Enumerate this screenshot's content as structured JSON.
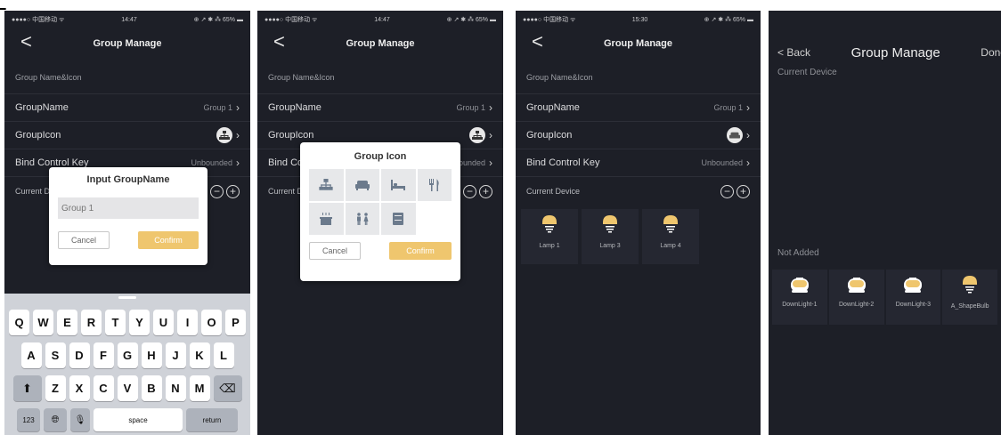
{
  "colors": {
    "screen_bg": "#1d1f27",
    "accent": "#efc66e",
    "dialog_bg": "#ffffff",
    "tile_bg": "#252731"
  },
  "screen1": {
    "status": {
      "left": "●●●●○ 中国移动 ᯤ",
      "time": "14:47",
      "right": "⊕ ↗ ✱ ⁂ 65% ▬"
    },
    "nav": {
      "back": "<",
      "title": "Group Manage"
    },
    "section_title": "Group Name&Icon",
    "rows": [
      {
        "label": "GroupName",
        "value": "Group 1"
      },
      {
        "label": "GroupIcon",
        "value": ""
      },
      {
        "label": "Bind Control Key",
        "value": "Unbounded"
      }
    ],
    "current_label": "Current Device",
    "dialog": {
      "title": "Input GroupName",
      "placeholder": "Group 1",
      "cancel": "Cancel",
      "confirm": "Confirm"
    },
    "keyboard": {
      "row1": [
        "Q",
        "W",
        "E",
        "R",
        "T",
        "Y",
        "U",
        "I",
        "O",
        "P"
      ],
      "row2": [
        "A",
        "S",
        "D",
        "F",
        "G",
        "H",
        "J",
        "K",
        "L"
      ],
      "row3": [
        "Z",
        "X",
        "C",
        "V",
        "B",
        "N",
        "M"
      ],
      "num": "123",
      "space": "space",
      "return": "return"
    }
  },
  "screen2": {
    "status": {
      "left": "●●●●○ 中国移动 ᯤ",
      "time": "14:47",
      "right": "⊕ ↗ ✱ ⁂ 65% ▬"
    },
    "nav": {
      "back": "<",
      "title": "Group Manage"
    },
    "section_title": "Group Name&Icon",
    "rows": [
      {
        "label": "GroupName",
        "value": "Group 1"
      },
      {
        "label": "GroupIcon",
        "value": ""
      },
      {
        "label": "Bind Control Key",
        "value": "Unbounded"
      }
    ],
    "current_label": "Current Device",
    "dialog": {
      "title": "Group Icon",
      "icons": [
        "hierarchy-icon",
        "sofa-icon",
        "bed-icon",
        "dining-icon",
        "stove-icon",
        "restroom-icon",
        "cabinet-icon"
      ],
      "cancel": "Cancel",
      "confirm": "Confirm"
    }
  },
  "screen3": {
    "status": {
      "left": "●●●●○ 中国移动 ᯤ",
      "time": "15:30",
      "right": "⊕ ↗ ✱ ⁂ 65% ▬"
    },
    "nav": {
      "back": "<",
      "title": "Group Manage"
    },
    "section_title": "Group Name&Icon",
    "rows": [
      {
        "label": "GroupName",
        "value": "Group 1"
      },
      {
        "label": "GroupIcon",
        "value": ""
      },
      {
        "label": "Bind Control Key",
        "value": "Unbounded"
      }
    ],
    "current_label": "Current Device",
    "devices": [
      "Lamp 1",
      "Lamp 3",
      "Lamp 4"
    ]
  },
  "screen4": {
    "nav": {
      "back": "< Back",
      "title": "Group Manage",
      "done": "Done"
    },
    "current_label": "Current Device",
    "not_added_label": "Not Added",
    "not_added": [
      {
        "name": "DownLight-1",
        "icon": "downlight-icon"
      },
      {
        "name": "DownLight-2",
        "icon": "downlight-icon"
      },
      {
        "name": "DownLight-3",
        "icon": "downlight-icon"
      },
      {
        "name": "A_ShapeBulb",
        "icon": "bulb-icon"
      }
    ]
  }
}
